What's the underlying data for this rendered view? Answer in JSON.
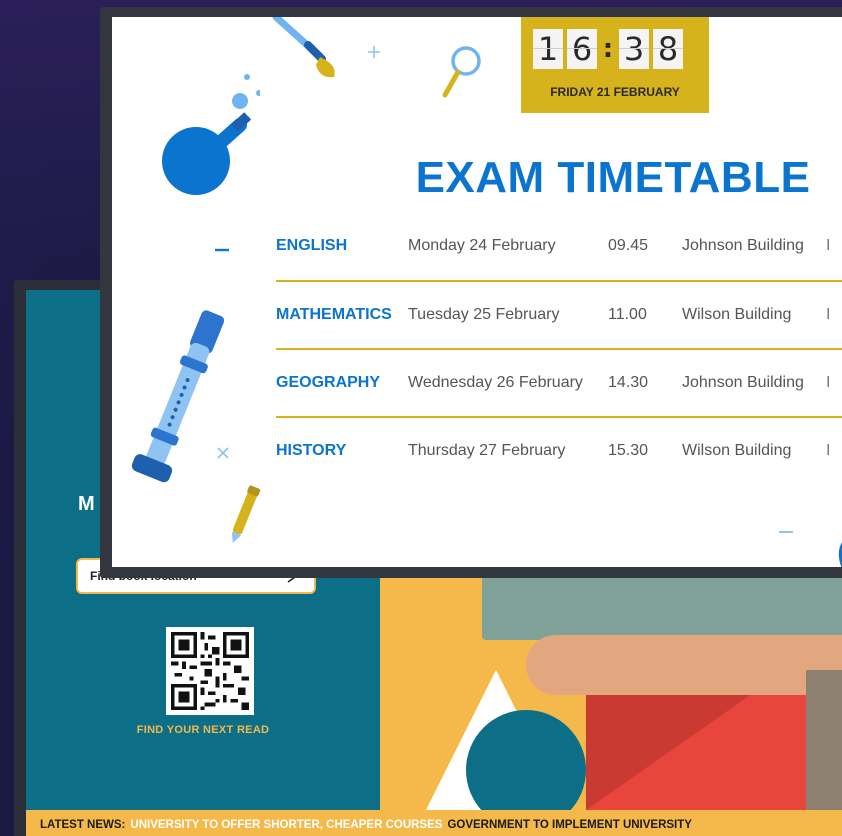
{
  "front_screen": {
    "clock": {
      "digits": [
        "1",
        "6",
        "3",
        "8"
      ],
      "separator": ":",
      "date": "FRIDAY 21 FEBRUARY"
    },
    "title": "EXAM TIMETABLE",
    "rows": [
      {
        "subject": "ENGLISH",
        "day": "Monday 24 February",
        "time": "09.45",
        "building": "Johnson Building",
        "extra": "I"
      },
      {
        "subject": "MATHEMATICS",
        "day": "Tuesday 25 February",
        "time": "11.00",
        "building": "Wilson Building",
        "extra": "I"
      },
      {
        "subject": "GEOGRAPHY",
        "day": "Wednesday 26 February",
        "time": "14.30",
        "building": "Johnson Building",
        "extra": "I"
      },
      {
        "subject": "HISTORY",
        "day": "Thursday 27 February",
        "time": "15.30",
        "building": "Wilson Building",
        "extra": "I"
      }
    ],
    "colors": {
      "accent_blue": "#0b74cf",
      "gold": "#d6b21d"
    }
  },
  "back_screen": {
    "partial_heading": "M",
    "search_placeholder": "Find book location",
    "qr_caption": "FIND YOUR NEXT READ",
    "ticker": {
      "label": "LATEST NEWS:",
      "item_one": "UNIVERSITY TO OFFER SHORTER, CHEAPER COURSES",
      "item_two": "GOVERNMENT TO IMPLEMENT UNIVERSITY"
    },
    "colors": {
      "teal": "#0c6f87",
      "orange": "#f5b84a",
      "red": "#e8453c"
    }
  },
  "icons": [
    "paintbrush-icon",
    "magnifier-icon",
    "flask-icon",
    "recorder-icon",
    "pen-icon",
    "plus-icon",
    "minus-icon",
    "cross-icon"
  ]
}
